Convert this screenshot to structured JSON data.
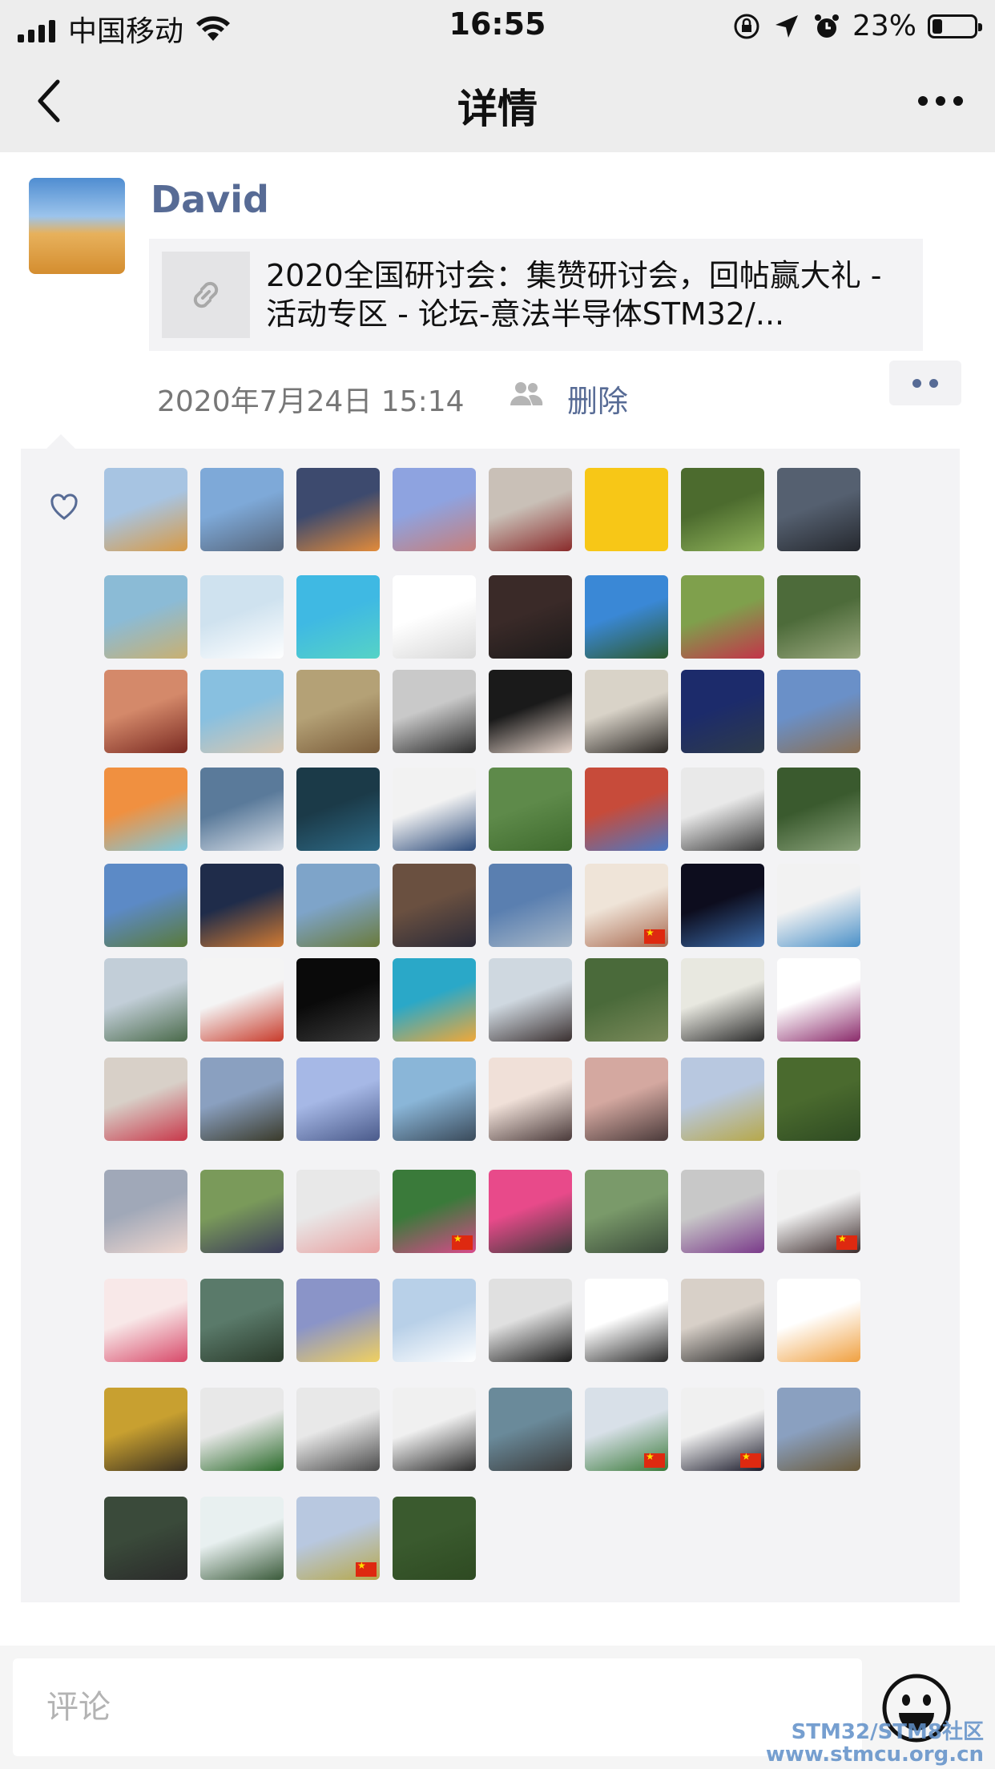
{
  "status_bar": {
    "carrier": "中国移动",
    "time": "16:55",
    "battery": "23%",
    "battery_level": 0.23
  },
  "nav": {
    "title": "详情"
  },
  "post": {
    "author": "David",
    "link_title": "2020全国研讨会：集赞研讨会，回帖赢大礼 - 活动专区 - 论坛-意法半导体STM32/...",
    "timestamp": "2020年7月24日 15:14",
    "delete_label": "删除"
  },
  "likes": {
    "avatars": [
      {
        "c1": "#a7c4e2",
        "c2": "#d89a45"
      },
      {
        "c1": "#7ea9d8",
        "c2": "#56657a"
      },
      {
        "c1": "#3d4a6e",
        "c2": "#e38b3a"
      },
      {
        "c1": "#8ea3e0",
        "c2": "#c77e7a"
      },
      {
        "c1": "#c9c0b7",
        "c2": "#8a2b2b"
      },
      {
        "c1": "#f7c717",
        "c2": "#f7c717"
      },
      {
        "c1": "#4c6b2e",
        "c2": "#8fb25a"
      },
      {
        "c1": "#556070",
        "c2": "#25282e"
      },
      {
        "c1": "#8bbbd6",
        "c2": "#c9b071"
      },
      {
        "c1": "#cfe2ef",
        "c2": "#ffffff"
      },
      {
        "c1": "#3fb9e3",
        "c2": "#56d3c6"
      },
      {
        "c1": "#ffffff",
        "c2": "#d8d8d8"
      },
      {
        "c1": "#3a2a28",
        "c2": "#1c1a1a"
      },
      {
        "c1": "#3a88d6",
        "c2": "#2e5a2e"
      },
      {
        "c1": "#7fa04c",
        "c2": "#c3344a"
      },
      {
        "c1": "#4d6b3a",
        "c2": "#9aa87e"
      },
      {
        "c1": "#d4896a",
        "c2": "#7a2a22"
      },
      {
        "c1": "#88c0e0",
        "c2": "#d9c7b0"
      },
      {
        "c1": "#b4a176",
        "c2": "#7a5c3a"
      },
      {
        "c1": "#c9c9c9",
        "c2": "#2a2a2a"
      },
      {
        "c1": "#1a1a1a",
        "c2": "#e8d6cc"
      },
      {
        "c1": "#d9d3c8",
        "c2": "#2b2724"
      },
      {
        "c1": "#1c2b6b",
        "c2": "#2e3b4a"
      },
      {
        "c1": "#6a90c8",
        "c2": "#8a6f52"
      },
      {
        "c1": "#f09040",
        "c2": "#7cc9e0"
      },
      {
        "c1": "#5a7a9a",
        "c2": "#d6dde6"
      },
      {
        "c1": "#1b3a48",
        "c2": "#2e6a86"
      },
      {
        "c1": "#f2f2f2",
        "c2": "#2b4a7a"
      },
      {
        "c1": "#5e8a4a",
        "c2": "#3f6b2e"
      },
      {
        "c1": "#c74b3a",
        "c2": "#4a79c6"
      },
      {
        "c1": "#e9e9e9",
        "c2": "#3a3a3a"
      },
      {
        "c1": "#3a5a2e",
        "c2": "#8aa27a"
      },
      {
        "c1": "#5c8ac6",
        "c2": "#5a7a3a"
      },
      {
        "c1": "#1f2c4a",
        "c2": "#d17a32"
      },
      {
        "c1": "#7ea4c9",
        "c2": "#6a7a3a"
      },
      {
        "c1": "#6a5040",
        "c2": "#2a2a38"
      },
      {
        "c1": "#5a7fb0",
        "c2": "#a8b8c8"
      },
      {
        "c1": "#efe4d8",
        "c2": "#a8684e"
      },
      {
        "c1": "#0d0d1e",
        "c2": "#3b6aa8"
      },
      {
        "c1": "#f2f2f2",
        "c2": "#4a90c8"
      },
      {
        "c1": "#c2ced8",
        "c2": "#4a6a4a"
      },
      {
        "c1": "#f4f4f4",
        "c2": "#c83a2a"
      },
      {
        "c1": "#0a0a0a",
        "c2": "#3a3a3a"
      },
      {
        "c1": "#2aa8c8",
        "c2": "#f0a838"
      },
      {
        "c1": "#cfd8e0",
        "c2": "#3a3030"
      },
      {
        "c1": "#4a6a3a",
        "c2": "#7a8a5a"
      },
      {
        "c1": "#e8e8e0",
        "c2": "#2a2a2a"
      },
      {
        "c1": "#ffffff",
        "c2": "#8a2a6a"
      },
      {
        "c1": "#d8d0c8",
        "c2": "#c8384a"
      },
      {
        "c1": "#8aa0c0",
        "c2": "#3a3a2a"
      },
      {
        "c1": "#a6b8e6",
        "c2": "#4a5a8a"
      },
      {
        "c1": "#8ab6d8",
        "c2": "#3a4a5a"
      },
      {
        "c1": "#f0e0d8",
        "c2": "#4a3a3a"
      },
      {
        "c1": "#d4a8a0",
        "c2": "#4a3a3a"
      },
      {
        "c1": "#b8c8e0",
        "c2": "#b7a84a"
      },
      {
        "c1": "#4a6a2e",
        "c2": "#2e4a22"
      },
      {
        "c1": "#a0a8b8",
        "c2": "#f0d8d0"
      },
      {
        "c1": "#7a9a5a",
        "c2": "#3a3a5a"
      },
      {
        "c1": "#e8e8e8",
        "c2": "#e8a0a0"
      },
      {
        "c1": "#3a7a3a",
        "c2": "#d84a8a"
      },
      {
        "c1": "#e84a8a",
        "c2": "#3a3a3a"
      },
      {
        "c1": "#7a9a6a",
        "c2": "#3a4a3a"
      },
      {
        "c1": "#c8c8c8",
        "c2": "#7a3a8a"
      },
      {
        "c1": "#f0f0f0",
        "c2": "#3a2a2a"
      },
      {
        "c1": "#f8e8e8",
        "c2": "#d84a6a"
      },
      {
        "c1": "#5a7a6a",
        "c2": "#2a3a2a"
      },
      {
        "c1": "#8a94c8",
        "c2": "#f0d060"
      },
      {
        "c1": "#b8d0e8",
        "c2": "#ffffff"
      },
      {
        "c1": "#e0e0e0",
        "c2": "#1a1a1a"
      },
      {
        "c1": "#ffffff",
        "c2": "#2a2a2a"
      },
      {
        "c1": "#d8d0c8",
        "c2": "#2a2a2a"
      },
      {
        "c1": "#ffffff",
        "c2": "#f0a040"
      },
      {
        "c1": "#c8a030",
        "c2": "#3a3020"
      },
      {
        "c1": "#e8e8e8",
        "c2": "#2a6a2a"
      },
      {
        "c1": "#e8e8e8",
        "c2": "#4a4a4a"
      },
      {
        "c1": "#f0f0f0",
        "c2": "#2a2a2a"
      },
      {
        "c1": "#6a8a9a",
        "c2": "#3a3a3a"
      },
      {
        "c1": "#d8e0e8",
        "c2": "#3a7a3a"
      },
      {
        "c1": "#f0f0f0",
        "c2": "#1a1a2a"
      },
      {
        "c1": "#8aa0c0",
        "c2": "#6a5a3a"
      },
      {
        "c1": "#3a4a3a",
        "c2": "#2a2a2a"
      },
      {
        "c1": "#e8f0f0",
        "c2": "#3a5a3a"
      },
      {
        "c1": "#b8c8e0",
        "c2": "#b7a84a"
      },
      {
        "c1": "#3a5a2e",
        "c2": "#2e4a22"
      }
    ],
    "flags_on": [
      37,
      59,
      63,
      77,
      78,
      82
    ]
  },
  "comment": {
    "placeholder": "评论"
  },
  "watermark": {
    "line1": "STM32/STM8社区",
    "line2": "www.stmcu.org.cn"
  },
  "icons": {
    "back": "chevron-left-icon",
    "more": "more-icon",
    "link": "link-icon",
    "people": "people-icon",
    "heart": "heart-icon",
    "emoji": "emoji-icon"
  },
  "colors": {
    "link_blue": "#576b95",
    "bar_bg": "#ededed",
    "panel_bg": "#f3f3f5"
  }
}
